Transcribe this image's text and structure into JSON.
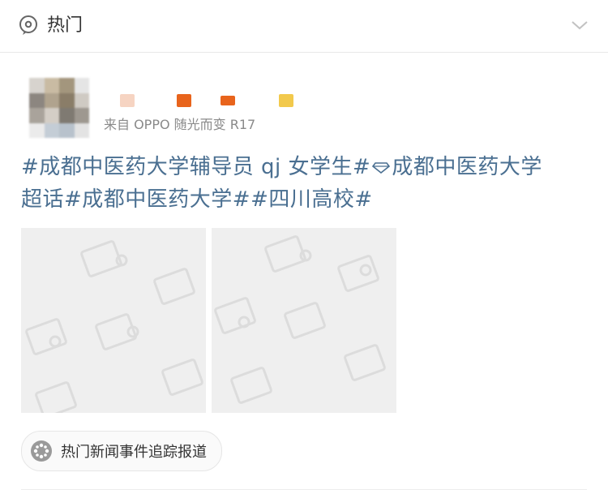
{
  "header": {
    "title": "热门",
    "icon": "hot-icon",
    "collapse_icon": "chevron-down-icon"
  },
  "post": {
    "source": "来自 OPPO 随光而变 R17",
    "text_line1_a": "#成都中医药大学辅导员 qj 女学生#",
    "text_line1_b": "成都中医药大学",
    "text_line2": "超话#成都中医药大学##四川高校#",
    "images": [
      {
        "name": "image-placeholder-1"
      },
      {
        "name": "image-placeholder-2"
      }
    ]
  },
  "topic": {
    "label": "热门新闻事件追踪报道",
    "icon": "topic-icon"
  },
  "colors": {
    "link": "#4a6f91",
    "divider": "#e9e9e9",
    "placeholder": "#efefef"
  }
}
